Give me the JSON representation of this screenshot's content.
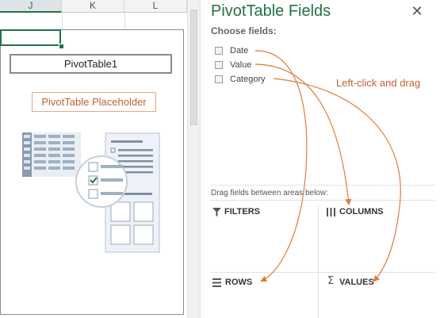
{
  "sheet": {
    "columns": [
      {
        "label": "J",
        "active": true
      },
      {
        "label": "K",
        "active": false
      },
      {
        "label": "L",
        "active": false
      }
    ],
    "pivot_name": "PivotTable1",
    "pivot_placeholder": "PivotTable Placeholder"
  },
  "panel": {
    "title": "PivotTable Fields",
    "close_icon": "close-icon",
    "choose_fields_label": "Choose fields:",
    "fields": [
      {
        "label": "Date",
        "checked": false
      },
      {
        "label": "Value",
        "checked": false
      },
      {
        "label": "Category",
        "checked": false
      }
    ],
    "annotation": "Left-click and drag",
    "drag_hint": "Drag fields between areas below:",
    "areas": {
      "filters": {
        "label": "FILTERS",
        "icon": "filter-icon"
      },
      "columns": {
        "label": "COLUMNS",
        "icon": "columns-icon"
      },
      "rows": {
        "label": "ROWS",
        "icon": "rows-icon"
      },
      "values": {
        "label": "VALUES",
        "icon": "sigma-icon"
      }
    }
  },
  "colors": {
    "accent_green": "#217346",
    "annotation_orange": "#e07b39"
  }
}
